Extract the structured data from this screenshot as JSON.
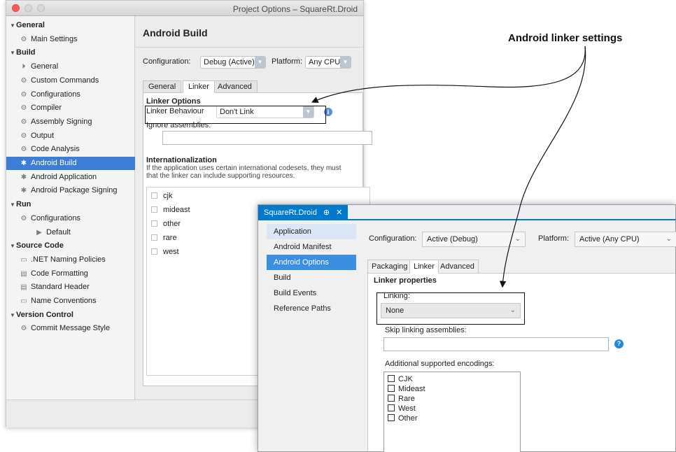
{
  "mac": {
    "title": "Project Options – SquareRt.Droid",
    "tree": [
      {
        "label": "General",
        "kind": "cat",
        "icon": "triangle-down-icon"
      },
      {
        "label": "Main Settings",
        "kind": "item",
        "icon": "gear-icon"
      },
      {
        "label": "Build",
        "kind": "cat",
        "icon": "triangle-down-icon"
      },
      {
        "label": "General",
        "kind": "item",
        "icon": "play-bar-icon"
      },
      {
        "label": "Custom Commands",
        "kind": "item",
        "icon": "gear-icon"
      },
      {
        "label": "Configurations",
        "kind": "item",
        "icon": "gear-icon"
      },
      {
        "label": "Compiler",
        "kind": "item",
        "icon": "gear-icon"
      },
      {
        "label": "Assembly Signing",
        "kind": "item",
        "icon": "gear-icon"
      },
      {
        "label": "Output",
        "kind": "item",
        "icon": "gear-icon"
      },
      {
        "label": "Code Analysis",
        "kind": "item",
        "icon": "gear-icon"
      },
      {
        "label": "Android Build",
        "kind": "item",
        "icon": "android-icon",
        "selected": true
      },
      {
        "label": "Android Application",
        "kind": "item",
        "icon": "android-icon"
      },
      {
        "label": "Android Package Signing",
        "kind": "item",
        "icon": "android-icon"
      },
      {
        "label": "Run",
        "kind": "cat",
        "icon": "triangle-down-icon"
      },
      {
        "label": "Configurations",
        "kind": "item",
        "icon": "gear-icon"
      },
      {
        "label": "Default",
        "kind": "sub",
        "icon": "play-icon"
      },
      {
        "label": "Source Code",
        "kind": "cat",
        "icon": "triangle-down-icon"
      },
      {
        "label": ".NET Naming Policies",
        "kind": "item",
        "icon": "rectangle-icon"
      },
      {
        "label": "Code Formatting",
        "kind": "item",
        "icon": "document-icon"
      },
      {
        "label": "Standard Header",
        "kind": "item",
        "icon": "document-icon"
      },
      {
        "label": "Name Conventions",
        "kind": "item",
        "icon": "rectangle-icon"
      },
      {
        "label": "Version Control",
        "kind": "cat",
        "icon": "triangle-down-icon"
      },
      {
        "label": "Commit Message Style",
        "kind": "item",
        "icon": "gear-icon"
      }
    ],
    "heading": "Android Build",
    "configuration_label": "Configuration:",
    "configuration_value": "Debug (Active)",
    "platform_label": "Platform:",
    "platform_value": "Any CPU",
    "tabs": [
      "General",
      "Linker",
      "Advanced"
    ],
    "active_tab": "Linker",
    "linker_options_title": "Linker Options",
    "linker_behaviour_label": "Linker Behaviour",
    "linker_behaviour_value": "Don't Link",
    "ignore_assemblies_label": "Ignore assemblies:",
    "intl_title": "Internationalization",
    "intl_desc_1": "If the application uses certain international codesets, they must",
    "intl_desc_2": "that the linker can include supporting resources.",
    "encodings": [
      "cjk",
      "mideast",
      "other",
      "rare",
      "west"
    ]
  },
  "win": {
    "doc_tab": "SquareRt.Droid",
    "doc_tab_pin": "⊕",
    "doc_tab_close": "✕",
    "nav": [
      {
        "label": "Application",
        "state": "light"
      },
      {
        "label": "Android Manifest",
        "state": ""
      },
      {
        "label": "Android Options",
        "state": "sel"
      },
      {
        "label": "Build",
        "state": ""
      },
      {
        "label": "Build Events",
        "state": ""
      },
      {
        "label": "Reference Paths",
        "state": ""
      }
    ],
    "configuration_label": "Configuration:",
    "configuration_value": "Active (Debug)",
    "platform_label": "Platform:",
    "platform_value": "Active (Any CPU)",
    "tabs": [
      "Packaging",
      "Linker",
      "Advanced"
    ],
    "active_tab": "Linker",
    "linker_properties_title": "Linker properties",
    "linking_label": "Linking:",
    "linking_value": "None",
    "skip_label": "Skip linking assemblies:",
    "encodings_label": "Additional supported encodings:",
    "encodings": [
      "CJK",
      "Mideast",
      "Rare",
      "West",
      "Other"
    ]
  },
  "annotation": "Android linker settings"
}
